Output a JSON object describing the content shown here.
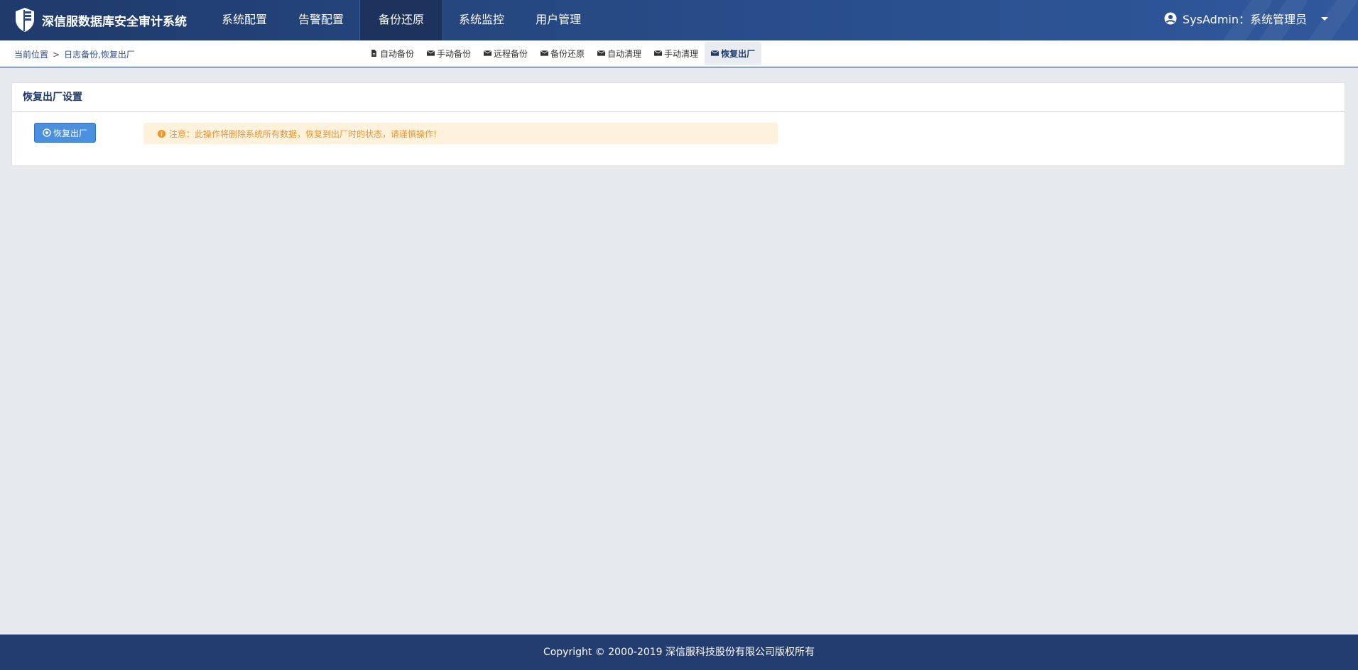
{
  "app": {
    "title": "深信服数据库安全审计系统"
  },
  "nav": {
    "items": [
      {
        "label": "系统配置",
        "active": false
      },
      {
        "label": "告警配置",
        "active": false
      },
      {
        "label": "备份还原",
        "active": true
      },
      {
        "label": "系统监控",
        "active": false
      },
      {
        "label": "用户管理",
        "active": false
      }
    ]
  },
  "user": {
    "label": "SysAdmin：系统管理员",
    "icon": "user-circle-icon"
  },
  "breadcrumb": {
    "root": "当前位置",
    "separator": ">",
    "current": "日志备份,恢复出厂"
  },
  "subtabs": [
    {
      "label": "自动备份",
      "icon": "file-icon",
      "active": false
    },
    {
      "label": "手动备份",
      "icon": "envelope-icon",
      "active": false
    },
    {
      "label": "远程备份",
      "icon": "envelope-icon",
      "active": false
    },
    {
      "label": "备份还原",
      "icon": "envelope-icon",
      "active": false
    },
    {
      "label": "自动清理",
      "icon": "envelope-icon",
      "active": false
    },
    {
      "label": "手动清理",
      "icon": "envelope-icon",
      "active": false
    },
    {
      "label": "恢复出厂",
      "icon": "envelope-icon",
      "active": true
    }
  ],
  "panel": {
    "title": "恢复出厂设置",
    "button_label": "恢复出厂",
    "warning": "注意：此操作将删除系统所有数据，恢复到出厂时的状态，请谨慎操作!"
  },
  "footer": {
    "copyright": "Copyright © 2000-2019 深信服科技股份有限公司版权所有"
  },
  "colors": {
    "nav_bg": "#274a85",
    "active_nav": "#1d325d",
    "button": "#4a8fe0",
    "warning_bg": "#fef2dd",
    "warning_text": "#f0932b",
    "footer_bg": "#243d70"
  }
}
